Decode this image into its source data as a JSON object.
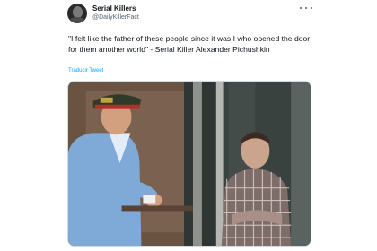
{
  "account": {
    "name": "Serial Killers",
    "handle": "@DailyKillerFact"
  },
  "tweet": {
    "text": "\"I felt like the father of these people since it was I who opened the door for them another world\" - Serial Killer Alexander Pichushkin",
    "translate_label": "Traducir Tweet"
  },
  "icons": {
    "avatar": "account-avatar",
    "more": "more-options-icon"
  },
  "colors": {
    "link": "#1d9bf0",
    "secondary_text": "#536471"
  }
}
